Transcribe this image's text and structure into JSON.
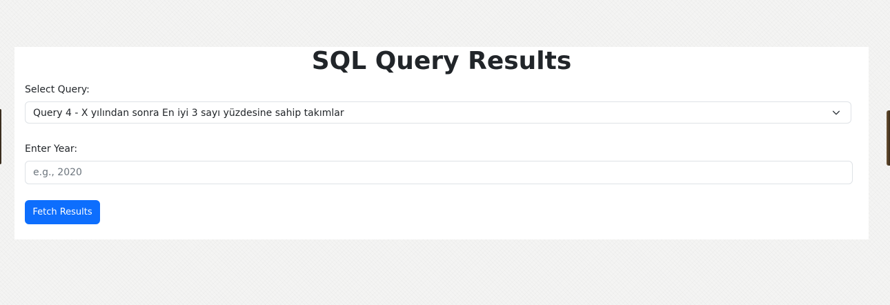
{
  "page": {
    "title": "SQL Query Results"
  },
  "query_select": {
    "label": "Select Query:",
    "selected": "Query 4 - X yılından sonra En iyi 3 sayı yüzdesine sahip takımlar",
    "icon": "chevron-down-icon"
  },
  "year_input": {
    "label": "Enter Year:",
    "value": "",
    "placeholder": "e.g., 2020"
  },
  "actions": {
    "fetch_label": "Fetch Results"
  },
  "colors": {
    "primary": "#0d6efd",
    "text": "#212529",
    "border": "#dee2e6",
    "card": "#ffffff",
    "page_bg": "#f4f4f3"
  }
}
